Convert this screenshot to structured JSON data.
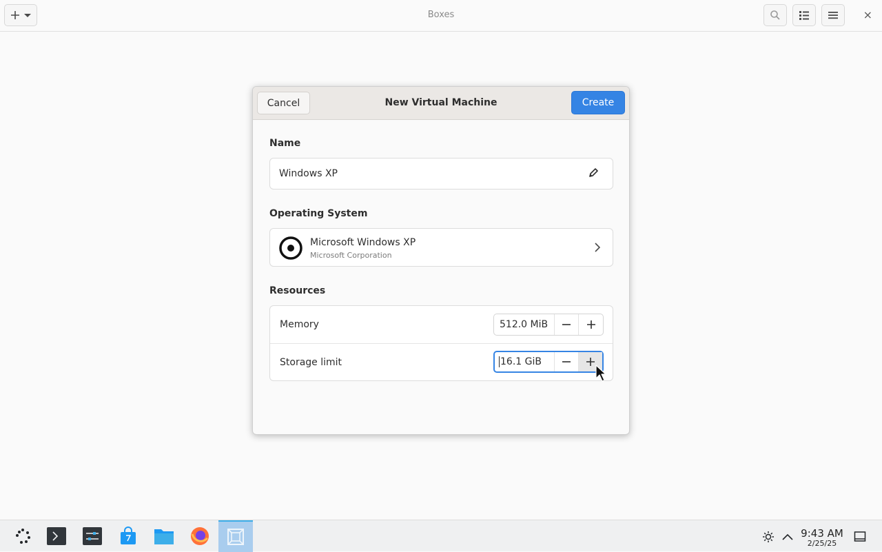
{
  "headerbar": {
    "title": "Boxes",
    "new_icon": "plus-icon",
    "dropdown_icon": "chevron-down-icon",
    "search_icon": "search-icon",
    "view_icon": "list-view-icon",
    "menu_icon": "hamburger-menu-icon",
    "close_label": "×"
  },
  "dialog": {
    "title": "New Virtual Machine",
    "cancel_label": "Cancel",
    "create_label": "Create",
    "name_section": "Name",
    "name_value": "Windows XP",
    "os_section": "Operating System",
    "os_name": "Microsoft Windows XP",
    "os_vendor": "Microsoft Corporation",
    "resources_section": "Resources",
    "memory_label": "Memory",
    "memory_value": "512.0 MiB",
    "storage_label": "Storage limit",
    "storage_value": "16.1 GiB"
  },
  "taskbar": {
    "items": [
      "app-launcher",
      "terminal",
      "system-settings",
      "discover-store",
      "file-manager",
      "firefox",
      "boxes"
    ],
    "active_item": "boxes",
    "time": "9:43 AM",
    "date": "2/25/25"
  },
  "colors": {
    "accent": "#3584e4",
    "taskbar_active": "#a9cdee"
  }
}
